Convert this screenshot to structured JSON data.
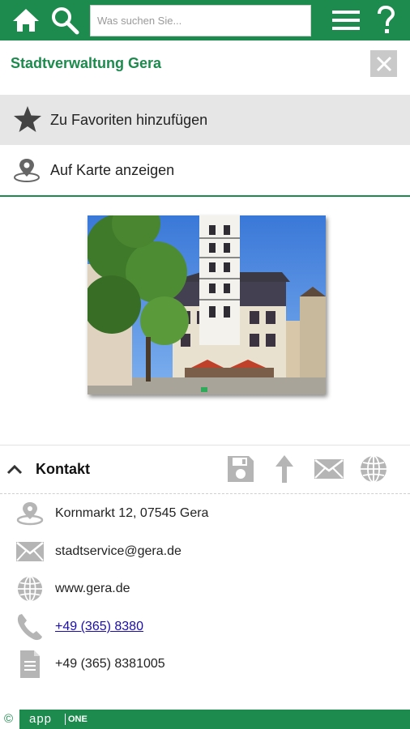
{
  "header": {
    "search_placeholder": "Was suchen Sie..."
  },
  "title": "Stadtverwaltung Gera",
  "actions": {
    "favorite_label": "Zu Favoriten hinzufügen",
    "map_label": "Auf Karte anzeigen"
  },
  "kontakt": {
    "heading": "Kontakt",
    "address": "Kornmarkt 12, 07545 Gera",
    "email": "stadtservice@gera.de",
    "web": "www.gera.de",
    "phone": "+49 (365) 8380",
    "fax": "+49 (365) 8381005"
  },
  "footer": {
    "copyright": "©",
    "brand": "app",
    "brand_suffix": "ONE"
  },
  "colors": {
    "accent": "#1d8a4e",
    "icon_gray": "#b5b5b5"
  },
  "icons": [
    "home-icon",
    "search-icon",
    "menu-icon",
    "help-icon",
    "close-icon",
    "star-icon",
    "map-pin-icon",
    "chevron-up-icon",
    "save-icon",
    "navigate-icon",
    "mail-icon",
    "globe-icon",
    "phone-icon",
    "document-icon"
  ]
}
